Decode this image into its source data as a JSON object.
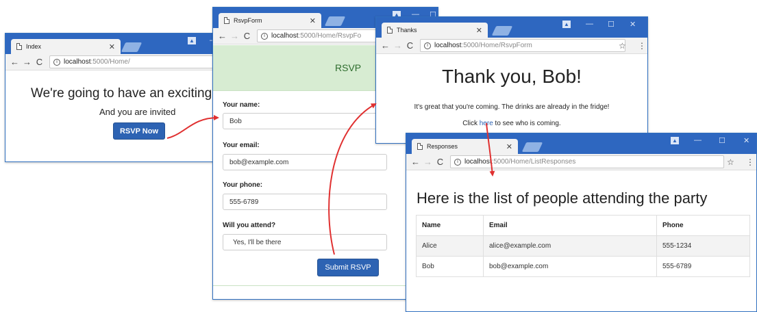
{
  "windows": {
    "index": {
      "tab_title": "Index",
      "url_host": "localhost",
      "url_path": ":5000/Home/",
      "heading": "We're going to have an exciting",
      "subheading": "And you are invited",
      "rsvp_button": "RSVP Now"
    },
    "form": {
      "tab_title": "RsvpForm",
      "url_host": "localhost",
      "url_path": ":5000/Home/RsvpFo",
      "header": "RSVP",
      "name_label": "Your name:",
      "name_value": "Bob",
      "email_label": "Your email:",
      "email_value": "bob@example.com",
      "phone_label": "Your phone:",
      "phone_value": "555-6789",
      "attend_label": "Will you attend?",
      "attend_value": "Yes, I'll be there",
      "submit_button": "Submit RSVP"
    },
    "thanks": {
      "tab_title": "Thanks",
      "url_host": "localhost",
      "url_path": ":5000/Home/RsvpForm",
      "heading": "Thank you, Bob!",
      "message": "It's great that you're coming. The drinks are already in the fridge!",
      "click_prefix": "Click ",
      "link_text": "here",
      "click_suffix": " to see who is coming."
    },
    "responses": {
      "tab_title": "Responses",
      "url_host": "localhost",
      "url_path": ":5000/Home/ListResponses",
      "heading": "Here is the list of people attending the party",
      "columns": [
        "Name",
        "Email",
        "Phone"
      ],
      "rows": [
        [
          "Alice",
          "alice@example.com",
          "555-1234"
        ],
        [
          "Bob",
          "bob@example.com",
          "555-6789"
        ]
      ]
    }
  },
  "colors": {
    "titlebar": "#2e67c0",
    "jumbotron": "#d7ecd2",
    "button": "#2d63b3",
    "arrow": "#e03030"
  }
}
